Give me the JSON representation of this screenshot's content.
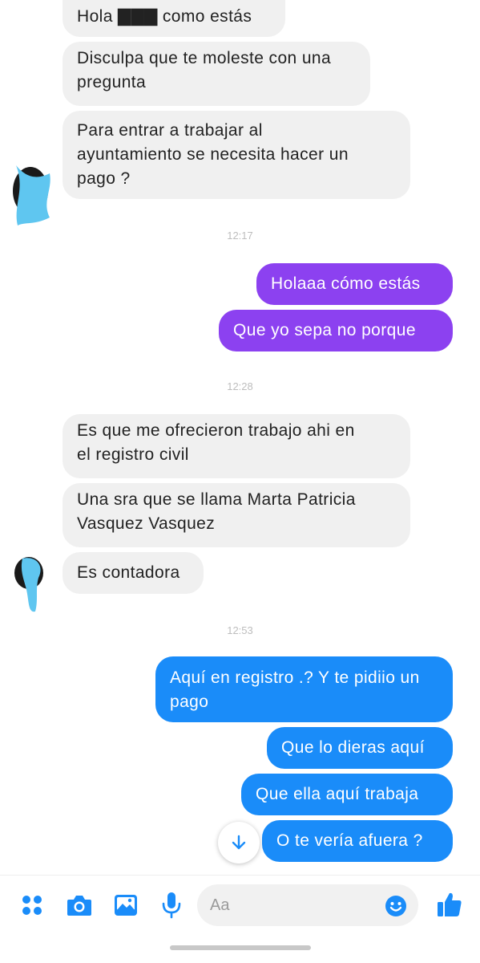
{
  "messages": {
    "m1": "Hola ▇▇▇ como estás",
    "m2": "Disculpa que te moleste con una\npregunta",
    "m3": "Para entrar a trabajar al\nayuntamiento se necesita hacer un\npago ?",
    "t1": "12:17",
    "m4": "Holaaa cómo estás",
    "m5": "Que yo sepa no porque",
    "t2": "12:28",
    "m6": "Es que me ofrecieron trabajo ahi en\nel registro civil",
    "m7": "Una sra que se llama Marta Patricia\nVasquez Vasquez",
    "m8": "Es contadora",
    "t3": "12:53",
    "m9": "Aquí en registro .? Y te pidiio un\npago",
    "m10": "Que lo dieras aquí",
    "m11": "Que ella aquí trabaja",
    "m12": "O te vería afuera ?"
  },
  "composer": {
    "placeholder": "Aa"
  },
  "colors": {
    "incoming": "#f0f0f0",
    "outgoing_purple": "#8c41f0",
    "outgoing_blue": "#1a8cf9",
    "icon_blue": "#1a8cf9"
  },
  "icons": {
    "menu": "four-dots-icon",
    "camera": "camera-icon",
    "gallery": "image-icon",
    "mic": "microphone-icon",
    "emoji": "smiley-icon",
    "like": "thumbs-up-icon",
    "scroll": "arrow-down-icon"
  }
}
